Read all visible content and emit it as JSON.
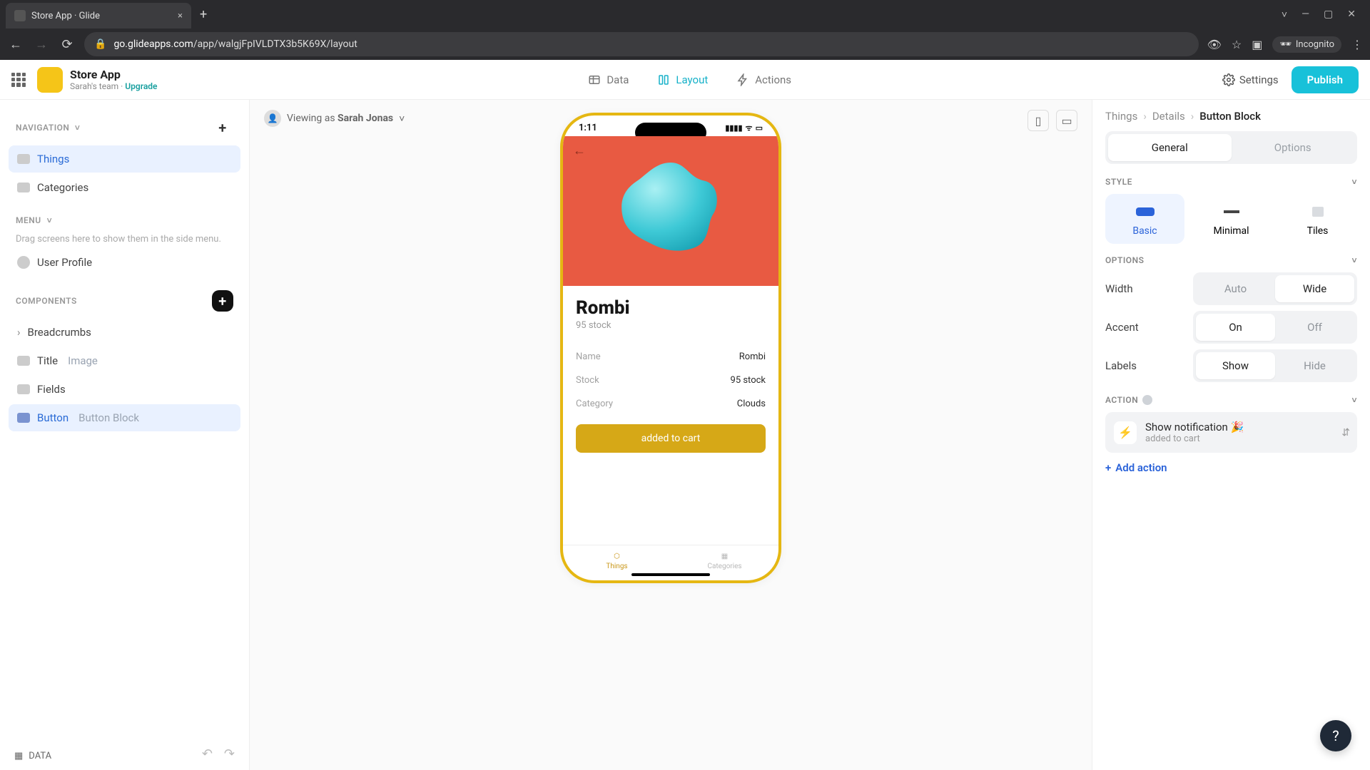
{
  "browser": {
    "tab_title": "Store App · Glide",
    "new_tab": "+",
    "close": "×",
    "url_host": "go.glideapps.com",
    "url_path": "/app/walgjFpIVLDTX3b5K69X/layout",
    "incognito": "Incognito",
    "window_controls": {
      "min": "—",
      "max": "▢",
      "close": "✕",
      "dropdown": "˅"
    }
  },
  "header": {
    "app_name": "Store App",
    "team": "Sarah's team",
    "sep": " · ",
    "upgrade": "Upgrade",
    "tabs": {
      "data": "Data",
      "layout": "Layout",
      "actions": "Actions"
    },
    "settings": "Settings",
    "publish": "Publish"
  },
  "left": {
    "navigation": "NAVIGATION",
    "nav_items": [
      "Things",
      "Categories"
    ],
    "menu": "MENU",
    "menu_hint": "Drag screens here to show them in the side menu.",
    "user_profile": "User Profile",
    "components": "COMPONENTS",
    "comp_breadcrumbs": "Breadcrumbs",
    "comp_title": "Title",
    "comp_title_sub": "Image",
    "comp_fields": "Fields",
    "comp_button": "Button",
    "comp_button_sub": "Button Block",
    "data_link": "DATA"
  },
  "canvas": {
    "viewing_prefix": "Viewing as ",
    "viewing_user": "Sarah Jonas"
  },
  "phone": {
    "time": "1:11",
    "signal": "▮▮▮▮",
    "wifi": "ᯤ",
    "battery": "▭",
    "title": "Rombi",
    "subtitle": "95 stock",
    "fields": [
      {
        "label": "Name",
        "value": "Rombi"
      },
      {
        "label": "Stock",
        "value": "95 stock"
      },
      {
        "label": "Category",
        "value": "Clouds"
      }
    ],
    "button": "added to cart",
    "nav_things": "Things",
    "nav_categories": "Categories"
  },
  "right": {
    "crumb1": "Things",
    "crumb2": "Details",
    "crumb3": "Button Block",
    "tab_general": "General",
    "tab_options": "Options",
    "style_head": "STYLE",
    "style_basic": "Basic",
    "style_minimal": "Minimal",
    "style_tiles": "Tiles",
    "options_head": "OPTIONS",
    "width_label": "Width",
    "width_auto": "Auto",
    "width_wide": "Wide",
    "accent_label": "Accent",
    "accent_on": "On",
    "accent_off": "Off",
    "labels_label": "Labels",
    "labels_show": "Show",
    "labels_hide": "Hide",
    "action_head": "ACTION",
    "action_title": "Show notification 🎉",
    "action_sub": "added to cart",
    "add_action": "Add action"
  }
}
